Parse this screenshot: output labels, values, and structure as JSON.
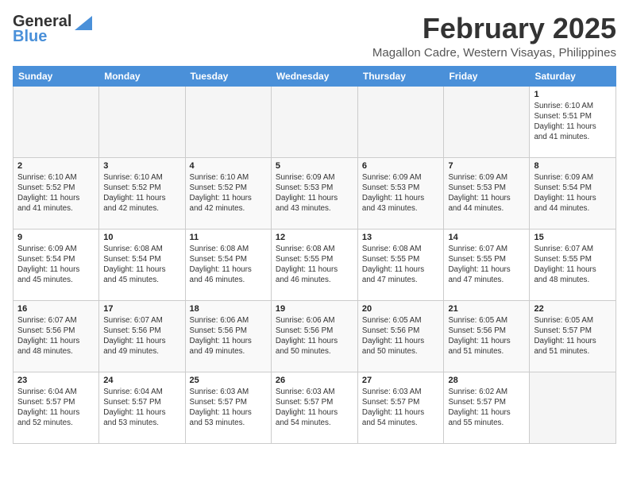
{
  "header": {
    "logo_general": "General",
    "logo_blue": "Blue",
    "month": "February 2025",
    "location": "Magallon Cadre, Western Visayas, Philippines"
  },
  "weekdays": [
    "Sunday",
    "Monday",
    "Tuesday",
    "Wednesday",
    "Thursday",
    "Friday",
    "Saturday"
  ],
  "weeks": [
    [
      {
        "day": "",
        "info": ""
      },
      {
        "day": "",
        "info": ""
      },
      {
        "day": "",
        "info": ""
      },
      {
        "day": "",
        "info": ""
      },
      {
        "day": "",
        "info": ""
      },
      {
        "day": "",
        "info": ""
      },
      {
        "day": "1",
        "info": "Sunrise: 6:10 AM\nSunset: 5:51 PM\nDaylight: 11 hours\nand 41 minutes."
      }
    ],
    [
      {
        "day": "2",
        "info": "Sunrise: 6:10 AM\nSunset: 5:52 PM\nDaylight: 11 hours\nand 41 minutes."
      },
      {
        "day": "3",
        "info": "Sunrise: 6:10 AM\nSunset: 5:52 PM\nDaylight: 11 hours\nand 42 minutes."
      },
      {
        "day": "4",
        "info": "Sunrise: 6:10 AM\nSunset: 5:52 PM\nDaylight: 11 hours\nand 42 minutes."
      },
      {
        "day": "5",
        "info": "Sunrise: 6:09 AM\nSunset: 5:53 PM\nDaylight: 11 hours\nand 43 minutes."
      },
      {
        "day": "6",
        "info": "Sunrise: 6:09 AM\nSunset: 5:53 PM\nDaylight: 11 hours\nand 43 minutes."
      },
      {
        "day": "7",
        "info": "Sunrise: 6:09 AM\nSunset: 5:53 PM\nDaylight: 11 hours\nand 44 minutes."
      },
      {
        "day": "8",
        "info": "Sunrise: 6:09 AM\nSunset: 5:54 PM\nDaylight: 11 hours\nand 44 minutes."
      }
    ],
    [
      {
        "day": "9",
        "info": "Sunrise: 6:09 AM\nSunset: 5:54 PM\nDaylight: 11 hours\nand 45 minutes."
      },
      {
        "day": "10",
        "info": "Sunrise: 6:08 AM\nSunset: 5:54 PM\nDaylight: 11 hours\nand 45 minutes."
      },
      {
        "day": "11",
        "info": "Sunrise: 6:08 AM\nSunset: 5:54 PM\nDaylight: 11 hours\nand 46 minutes."
      },
      {
        "day": "12",
        "info": "Sunrise: 6:08 AM\nSunset: 5:55 PM\nDaylight: 11 hours\nand 46 minutes."
      },
      {
        "day": "13",
        "info": "Sunrise: 6:08 AM\nSunset: 5:55 PM\nDaylight: 11 hours\nand 47 minutes."
      },
      {
        "day": "14",
        "info": "Sunrise: 6:07 AM\nSunset: 5:55 PM\nDaylight: 11 hours\nand 47 minutes."
      },
      {
        "day": "15",
        "info": "Sunrise: 6:07 AM\nSunset: 5:55 PM\nDaylight: 11 hours\nand 48 minutes."
      }
    ],
    [
      {
        "day": "16",
        "info": "Sunrise: 6:07 AM\nSunset: 5:56 PM\nDaylight: 11 hours\nand 48 minutes."
      },
      {
        "day": "17",
        "info": "Sunrise: 6:07 AM\nSunset: 5:56 PM\nDaylight: 11 hours\nand 49 minutes."
      },
      {
        "day": "18",
        "info": "Sunrise: 6:06 AM\nSunset: 5:56 PM\nDaylight: 11 hours\nand 49 minutes."
      },
      {
        "day": "19",
        "info": "Sunrise: 6:06 AM\nSunset: 5:56 PM\nDaylight: 11 hours\nand 50 minutes."
      },
      {
        "day": "20",
        "info": "Sunrise: 6:05 AM\nSunset: 5:56 PM\nDaylight: 11 hours\nand 50 minutes."
      },
      {
        "day": "21",
        "info": "Sunrise: 6:05 AM\nSunset: 5:56 PM\nDaylight: 11 hours\nand 51 minutes."
      },
      {
        "day": "22",
        "info": "Sunrise: 6:05 AM\nSunset: 5:57 PM\nDaylight: 11 hours\nand 51 minutes."
      }
    ],
    [
      {
        "day": "23",
        "info": "Sunrise: 6:04 AM\nSunset: 5:57 PM\nDaylight: 11 hours\nand 52 minutes."
      },
      {
        "day": "24",
        "info": "Sunrise: 6:04 AM\nSunset: 5:57 PM\nDaylight: 11 hours\nand 53 minutes."
      },
      {
        "day": "25",
        "info": "Sunrise: 6:03 AM\nSunset: 5:57 PM\nDaylight: 11 hours\nand 53 minutes."
      },
      {
        "day": "26",
        "info": "Sunrise: 6:03 AM\nSunset: 5:57 PM\nDaylight: 11 hours\nand 54 minutes."
      },
      {
        "day": "27",
        "info": "Sunrise: 6:03 AM\nSunset: 5:57 PM\nDaylight: 11 hours\nand 54 minutes."
      },
      {
        "day": "28",
        "info": "Sunrise: 6:02 AM\nSunset: 5:57 PM\nDaylight: 11 hours\nand 55 minutes."
      },
      {
        "day": "",
        "info": ""
      }
    ]
  ]
}
